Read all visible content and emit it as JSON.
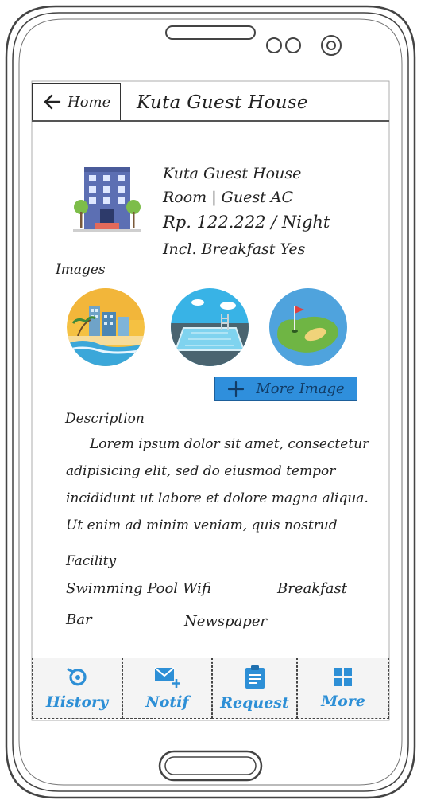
{
  "header": {
    "back_label": "Home",
    "title": "Kuta Guest House"
  },
  "hotel": {
    "name": "Kuta Guest House",
    "room": "Room | Guest AC",
    "price": "Rp. 122.222 / Night",
    "breakfast": "Incl. Breakfast Yes"
  },
  "images": {
    "label": "Images",
    "thumbnails": [
      "beach-hotel-icon",
      "swimming-pool-icon",
      "golf-course-icon"
    ],
    "more_button": "More Image"
  },
  "description": {
    "label": "Description",
    "text": "Lorem ipsum dolor sit amet, consectetur adipisicing elit, sed do eiusmod tempor incididunt ut labore et dolore magna aliqua. Ut enim ad minim veniam, quis nostrud"
  },
  "facility": {
    "label": "Facility",
    "items": [
      "Swimming Pool",
      "Wifi",
      "Breakfast",
      "Bar",
      "Newspaper"
    ]
  },
  "tabs": [
    {
      "label": "History",
      "icon": "history-icon"
    },
    {
      "label": "Notif",
      "icon": "mail-plus-icon"
    },
    {
      "label": "Request",
      "icon": "clipboard-icon"
    },
    {
      "label": "More",
      "icon": "grid-icon"
    }
  ],
  "colors": {
    "accent": "#2f8fdc",
    "tab_text": "#2d8fd6"
  }
}
